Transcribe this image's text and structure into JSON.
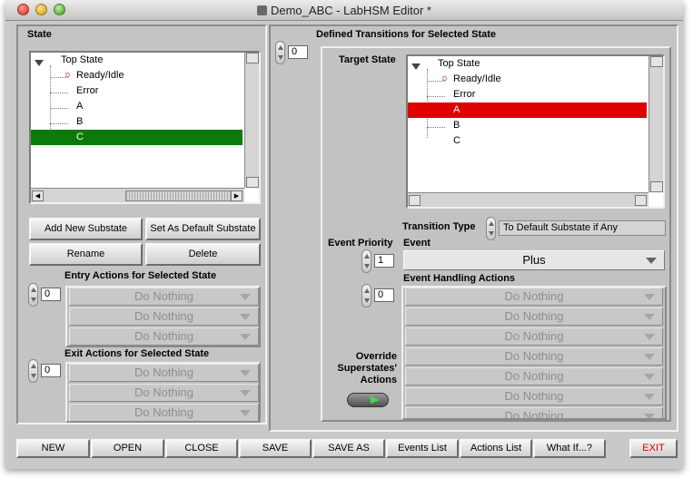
{
  "window": {
    "title": "Demo_ABC - LabHSM Editor *"
  },
  "state_panel": {
    "label": "State",
    "tree": [
      {
        "label": "Top State"
      },
      {
        "label": "Ready/Idle",
        "default_marker": "D"
      },
      {
        "label": "Error"
      },
      {
        "label": "A"
      },
      {
        "label": "B"
      },
      {
        "label": "C",
        "selected": true
      }
    ],
    "add_substate_button": "Add New Substate",
    "set_default_button": "Set As Default Substate",
    "rename_button": "Rename",
    "delete_button": "Delete"
  },
  "entry_actions": {
    "label": "Entry Actions for Selected State",
    "index": "0",
    "items": [
      "Do Nothing",
      "Do Nothing",
      "Do Nothing"
    ]
  },
  "exit_actions": {
    "label": "Exit Actions for Selected State",
    "index": "0",
    "items": [
      "Do Nothing",
      "Do Nothing",
      "Do Nothing"
    ]
  },
  "transitions": {
    "label": "Defined Transitions for Selected State",
    "index": "0",
    "target_state_label": "Target State",
    "tree": [
      {
        "label": "Top State"
      },
      {
        "label": "Ready/Idle",
        "default_marker": "D"
      },
      {
        "label": "Error"
      },
      {
        "label": "A",
        "selected": true
      },
      {
        "label": "B"
      },
      {
        "label": "C"
      }
    ],
    "transition_type_label": "Transition Type",
    "transition_type_value": "To Default Substate if Any",
    "event_priority_label": "Event Priority",
    "event_priority_value": "1",
    "event_label": "Event",
    "event_value": "Plus",
    "event_handling_label": "Event Handling Actions",
    "event_handling_index": "0",
    "event_handling_items": [
      "Do Nothing",
      "Do Nothing",
      "Do Nothing",
      "Do Nothing",
      "Do Nothing",
      "Do Nothing",
      "Do Nothing"
    ],
    "override_label_line1": "Override",
    "override_label_line2": "Superstates'",
    "override_label_line3": "Actions",
    "override_on": true
  },
  "toolbar": {
    "new": "NEW",
    "open": "OPEN",
    "close": "CLOSE",
    "save": "SAVE",
    "save_as": "SAVE AS",
    "events_list": "Events List",
    "actions_list": "Actions List",
    "what_if": "What If...?",
    "exit": "EXIT"
  },
  "colors": {
    "selected_green": "#0a7a0a",
    "selected_red": "#e00000",
    "exit_text": "#d40000",
    "led_green": "#3ee03e"
  }
}
